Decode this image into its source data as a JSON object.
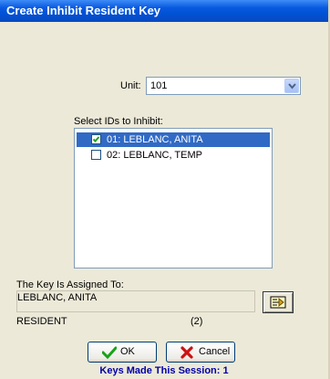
{
  "window": {
    "title": "Create Inhibit Resident Key"
  },
  "unit": {
    "label": "Unit:",
    "value": "101"
  },
  "ids": {
    "label": "Select IDs to Inhibit:",
    "items": [
      {
        "text": "01: LEBLANC, ANITA",
        "checked": true,
        "selected": true
      },
      {
        "text": "02: LEBLANC, TEMP",
        "checked": false,
        "selected": false
      }
    ]
  },
  "assignment": {
    "label": "The Key Is Assigned To:",
    "name": "LEBLANC, ANITA",
    "type": "RESIDENT",
    "count": "(2)"
  },
  "buttons": {
    "ok": "OK",
    "cancel": "Cancel"
  },
  "footer": {
    "session_text": "Keys Made This Session: 1"
  },
  "colors": {
    "title_bar": "#0A5AE0",
    "selection": "#316AC5",
    "footer_text": "#0000A8"
  }
}
